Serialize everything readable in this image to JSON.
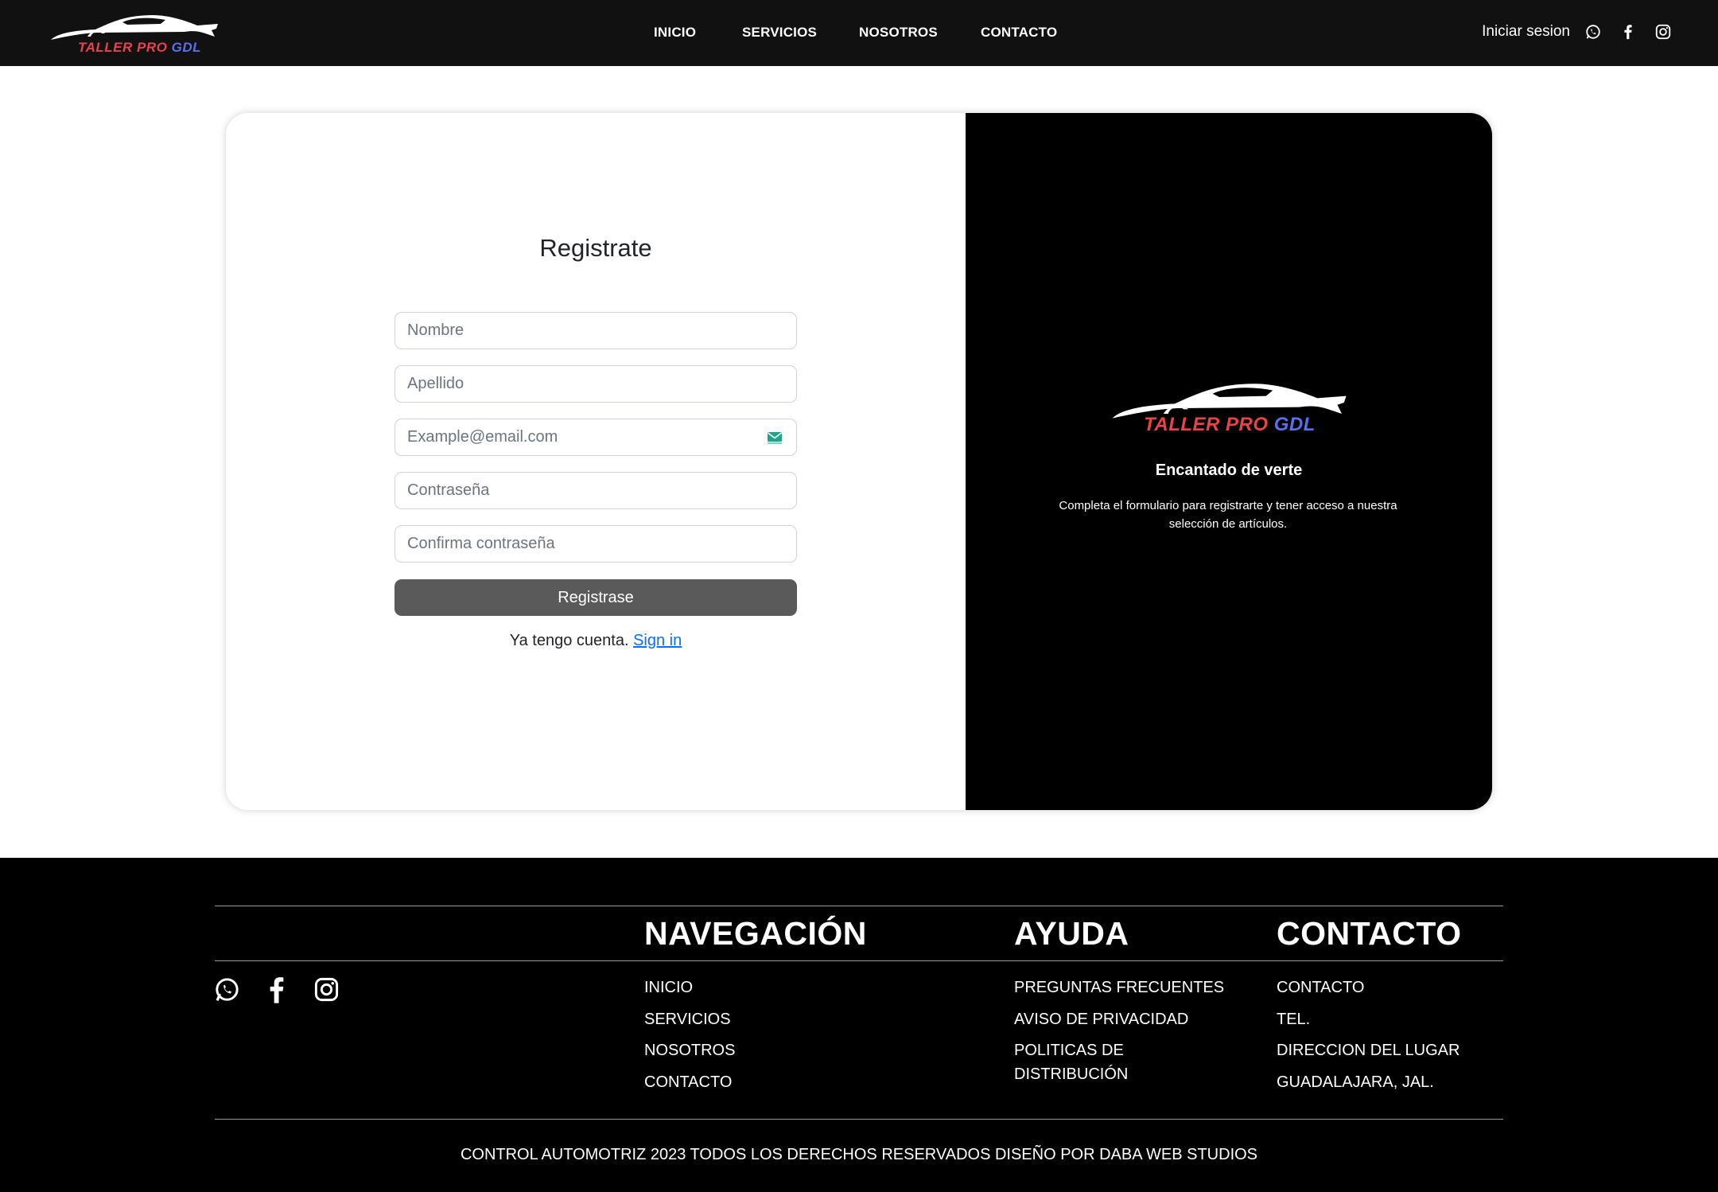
{
  "brand": {
    "name_part1": "TALLER PRO",
    "name_part2": "GDL",
    "color_red": "#e8424d",
    "color_blue": "#5b6fe8"
  },
  "nav": {
    "items": [
      {
        "label": "INICIO"
      },
      {
        "label": "SERVICIOS"
      },
      {
        "label": "NOSOTROS"
      },
      {
        "label": "CONTACTO"
      }
    ],
    "login_label": "Iniciar sesion",
    "social_icons": [
      "whatsapp-icon",
      "facebook-icon",
      "instagram-icon"
    ]
  },
  "form": {
    "title": "Registrate",
    "fields": {
      "first_name": {
        "placeholder": "Nombre",
        "value": ""
      },
      "last_name": {
        "placeholder": "Apellido",
        "value": ""
      },
      "email": {
        "placeholder": "Example@email.com",
        "value": "",
        "icon": "mail-icon"
      },
      "password": {
        "placeholder": "Contraseña",
        "value": ""
      },
      "confirm_password": {
        "placeholder": "Confirma contraseña",
        "value": ""
      }
    },
    "submit_label": "Registrase",
    "signin_prompt": "Ya tengo cuenta.",
    "signin_link": "Sign in"
  },
  "welcome": {
    "heading": "Encantado de verte",
    "text": "Completa el formulario para registrarte y tener acceso a nuestra selección de artículos."
  },
  "footer": {
    "navigation": {
      "heading": "NAVEGACIÓN",
      "items": [
        "INICIO",
        "SERVICIOS",
        "NOSOTROS",
        "CONTACTO"
      ]
    },
    "help": {
      "heading": "AYUDA",
      "items": [
        "PREGUNTAS FRECUENTES",
        "AVISO DE PRIVACIDAD",
        "POLITICAS DE DISTRIBUCIÓN"
      ]
    },
    "contact": {
      "heading": "CONTACTO",
      "items": [
        "CONTACTO",
        "TEL.",
        "DIRECCION DEL LUGAR",
        "GUADALAJARA, JAL."
      ]
    },
    "social_icons": [
      "whatsapp-icon",
      "facebook-icon",
      "instagram-icon"
    ],
    "copyright": "CONTROL AUTOMOTRIZ 2023 TODOS LOS DERECHOS RESERVADOS DISEÑO POR DABA WEB STUDIOS"
  }
}
